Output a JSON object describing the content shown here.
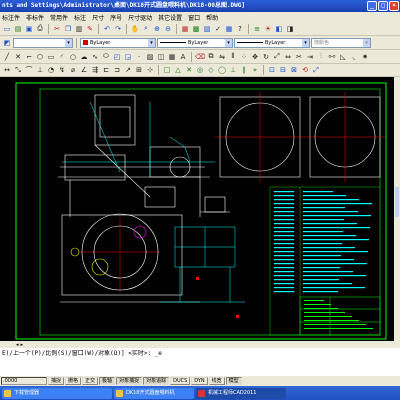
{
  "window": {
    "title": "nts and Settings\\Administrator\\桌面\\DK18开式圆盘喂料机\\DK18-00总图.DWG]",
    "buttons": [
      "_",
      "□",
      "×"
    ]
  },
  "menu": {
    "items": [
      "标注件",
      "非标件",
      "常用件",
      "标注",
      "尺寸",
      "序号",
      "尺寸驱动",
      "其它设置",
      "窗口",
      "帮助"
    ]
  },
  "toolbar2": {
    "color_combo": "ByLayer",
    "linetype_combo": "ByLayer",
    "lineweight_combo": "ByLayer",
    "plotstyle_combo": "随颜色"
  },
  "command": {
    "line1": "E)/上一个(P)/比例(S)/窗口(W)/对象(O)] <实时>: _e",
    "line2": ""
  },
  "status": {
    "coordinates": ".0000",
    "toggles": [
      "捕捉",
      "栅格",
      "正交",
      "极轴",
      "对象捕捉",
      "对象追踪",
      "DUCS",
      "DYN",
      "线宽",
      "模型"
    ],
    "active_toggles": [
      "极轴",
      "对象捕捉",
      "对象追踪",
      "模型"
    ]
  },
  "taskbar": {
    "items": [
      "下载管理器",
      "DK18开式圆盘喂料机",
      "机械工程师CAD2011"
    ],
    "active_index": 2
  },
  "colors": {
    "title_bar": "#1a3fae",
    "drawing_bg": "#000000",
    "frame_line": "#00ff00",
    "drawing_line": "#ffffff",
    "annotation": "#00ffff",
    "red_marks": "#ff0000"
  }
}
